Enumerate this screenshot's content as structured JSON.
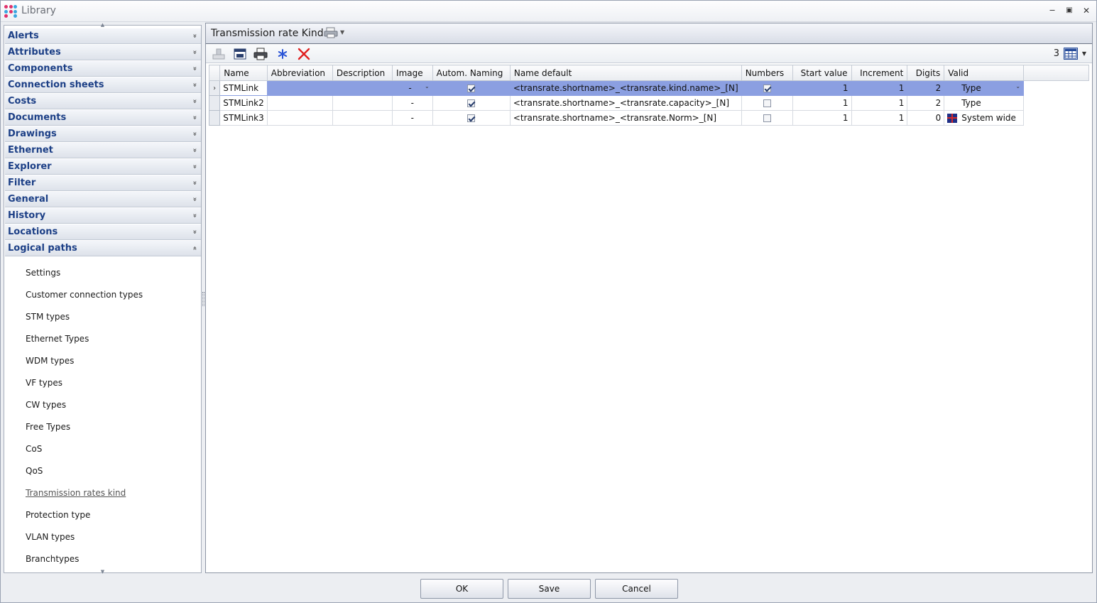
{
  "window": {
    "title": "Library",
    "controls": {
      "minimize": "‒",
      "maximize": "▣",
      "close": "✕"
    }
  },
  "nav": {
    "sections": [
      {
        "label": "Alerts",
        "expanded": false
      },
      {
        "label": "Attributes",
        "expanded": false
      },
      {
        "label": "Components",
        "expanded": false
      },
      {
        "label": "Connection sheets",
        "expanded": false
      },
      {
        "label": "Costs",
        "expanded": false
      },
      {
        "label": "Documents",
        "expanded": false
      },
      {
        "label": "Drawings",
        "expanded": false
      },
      {
        "label": "Ethernet",
        "expanded": false
      },
      {
        "label": "Explorer",
        "expanded": false
      },
      {
        "label": "Filter",
        "expanded": false
      },
      {
        "label": "General",
        "expanded": false
      },
      {
        "label": "History",
        "expanded": false
      },
      {
        "label": "Locations",
        "expanded": false
      },
      {
        "label": "Logical paths",
        "expanded": true
      }
    ],
    "items": [
      "Settings",
      "Customer connection types",
      "STM types",
      "Ethernet Types",
      "WDM types",
      "VF types",
      "CW types",
      "Free Types",
      "CoS",
      "QoS",
      "Transmission rates kind",
      "Protection type",
      "VLAN types",
      "Branchtypes"
    ],
    "active_item": "Transmission rates kind",
    "chevron_collapsed": "»",
    "chevron_expanded": "«"
  },
  "panel": {
    "title": "Transmission rate Kind",
    "record_count": "3",
    "toolbar_icons": [
      "insert-row-icon",
      "save-icon",
      "print-icon",
      "freeze-icon",
      "delete-icon"
    ]
  },
  "table": {
    "columns": [
      "Name",
      "Abbreviation",
      "Description",
      "Image",
      "Autom. Naming",
      "Name default",
      "Numbers",
      "Start value",
      "Increment",
      "Digits",
      "Valid"
    ],
    "rows": [
      {
        "name": "STMLink",
        "abbreviation": "",
        "description": "",
        "image": "-",
        "autom_naming": true,
        "name_default": "<transrate.shortname>_<transrate.kind.name>_[N]",
        "numbers": true,
        "start_value": "1",
        "increment": "1",
        "digits": "2",
        "valid": "Type",
        "selected": true
      },
      {
        "name": "STMLink2",
        "abbreviation": "",
        "description": "",
        "image": "-",
        "autom_naming": true,
        "name_default": "<transrate.shortname>_<transrate.capacity>_[N]",
        "numbers": false,
        "start_value": "1",
        "increment": "1",
        "digits": "2",
        "valid": "Type",
        "selected": false
      },
      {
        "name": "STMLink3",
        "abbreviation": "",
        "description": "",
        "image": "-",
        "autom_naming": true,
        "name_default": "<transrate.shortname>_<transrate.Norm>_[N]",
        "numbers": false,
        "start_value": "1",
        "increment": "1",
        "digits": "0",
        "valid": "System wide",
        "selected": false
      }
    ]
  },
  "buttons": {
    "ok": "OK",
    "save": "Save",
    "cancel": "Cancel"
  },
  "colors": {
    "selection": "#8b9fe1",
    "nav_header_text": "#1c3f86",
    "delete_red": "#e02020",
    "freeze_blue": "#2a54d6"
  }
}
